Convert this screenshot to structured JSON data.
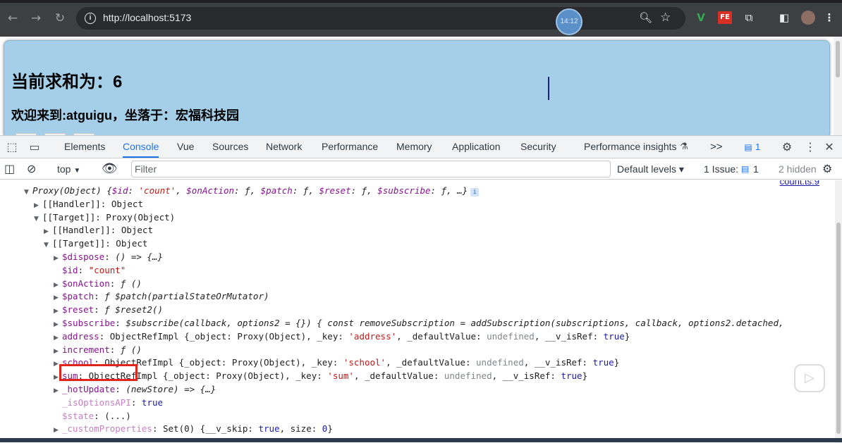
{
  "browser": {
    "url": "http://localhost:5173",
    "timer": "14:12",
    "extensions": [
      "V",
      "FE"
    ]
  },
  "page": {
    "sum_text": "当前求和为：6",
    "welcome_text": "欢迎来到:atguigu，坐落于：宏福科技园"
  },
  "devtools": {
    "tabs": [
      "Elements",
      "Console",
      "Vue",
      "Sources",
      "Network",
      "Performance",
      "Memory",
      "Application",
      "Security",
      "Performance insights"
    ],
    "more": ">>",
    "messages_count": "1",
    "context": "top",
    "filter_placeholder": "Filter",
    "levels": "Default levels ▾",
    "issues_label": "1 Issue:",
    "issues_count": "1",
    "hidden": "2 hidden",
    "source_link": "count.ts:9"
  },
  "console": {
    "lines": [
      {
        "t": "▼",
        "indent": 0,
        "parts": [
          [
            "i",
            "Proxy(Object) "
          ],
          [
            "i",
            "{"
          ],
          [
            "ki",
            "$id"
          ],
          [
            "i",
            ": "
          ],
          [
            "si",
            "'count'"
          ],
          [
            "i",
            ", "
          ],
          [
            "ki",
            "$onAction"
          ],
          [
            "i",
            ": ƒ, "
          ],
          [
            "ki",
            "$patch"
          ],
          [
            "i",
            ": ƒ, "
          ],
          [
            "ki",
            "$reset"
          ],
          [
            "i",
            ": ƒ, "
          ],
          [
            "ki",
            "$subscribe"
          ],
          [
            "i",
            ": ƒ, …}"
          ]
        ],
        "badge": "i"
      },
      {
        "t": "▶",
        "indent": 1,
        "parts": [
          [
            "",
            "[[Handler]]: Object"
          ]
        ]
      },
      {
        "t": "▼",
        "indent": 1,
        "parts": [
          [
            "",
            "[[Target]]: Proxy(Object)"
          ]
        ]
      },
      {
        "t": "▶",
        "indent": 2,
        "parts": [
          [
            "",
            "[[Handler]]: Object"
          ]
        ]
      },
      {
        "t": "▼",
        "indent": 2,
        "parts": [
          [
            "",
            "[[Target]]: Object"
          ]
        ]
      },
      {
        "t": "▶",
        "indent": 3,
        "parts": [
          [
            "k",
            "$dispose"
          ],
          [
            "",
            ": "
          ],
          [
            "i",
            "() => {…}"
          ]
        ]
      },
      {
        "t": "",
        "indent": 3,
        "parts": [
          [
            "k",
            "$id"
          ],
          [
            "",
            ": "
          ],
          [
            "s",
            "\"count\""
          ]
        ]
      },
      {
        "t": "▶",
        "indent": 3,
        "parts": [
          [
            "k",
            "$onAction"
          ],
          [
            "",
            ": "
          ],
          [
            "i",
            "ƒ ()"
          ]
        ]
      },
      {
        "t": "▶",
        "indent": 3,
        "parts": [
          [
            "k",
            "$patch"
          ],
          [
            "",
            ": "
          ],
          [
            "i",
            "ƒ $patch(partialStateOrMutator)"
          ]
        ]
      },
      {
        "t": "▶",
        "indent": 3,
        "parts": [
          [
            "k",
            "$reset"
          ],
          [
            "",
            ": "
          ],
          [
            "i",
            "ƒ $reset2()"
          ]
        ]
      },
      {
        "t": "▶",
        "indent": 3,
        "parts": [
          [
            "k",
            "$subscribe"
          ],
          [
            "",
            ": "
          ],
          [
            "i",
            "$subscribe(callback, options2 = {}) { const removeSubscription = addSubscription(subscriptions, callback, options2.detached,"
          ]
        ]
      },
      {
        "t": "▶",
        "indent": 3,
        "parts": [
          [
            "k",
            "address"
          ],
          [
            "",
            ": ObjectRefImpl {_object: Proxy(Object), _key: "
          ],
          [
            "s",
            "'address'"
          ],
          [
            "",
            ", _defaultValue: "
          ],
          [
            "g",
            "undefined"
          ],
          [
            "",
            ", __v_isRef: "
          ],
          [
            "n",
            "true"
          ],
          [
            "",
            "}"
          ]
        ]
      },
      {
        "t": "▶",
        "indent": 3,
        "parts": [
          [
            "k",
            "increment"
          ],
          [
            "",
            ": "
          ],
          [
            "i",
            "ƒ ()"
          ]
        ]
      },
      {
        "t": "▶",
        "indent": 3,
        "parts": [
          [
            "k",
            "school"
          ],
          [
            "",
            ": ObjectRefImpl {_object: Proxy(Object), _key: "
          ],
          [
            "s",
            "'school'"
          ],
          [
            "",
            ", _defaultValue: "
          ],
          [
            "g",
            "undefined"
          ],
          [
            "",
            ", __v_isRef: "
          ],
          [
            "n",
            "true"
          ],
          [
            "",
            "}"
          ]
        ]
      },
      {
        "t": "▶",
        "indent": 3,
        "parts": [
          [
            "k",
            "sum"
          ],
          [
            "",
            ": ObjectRefImpl {_object: Proxy(Object), _key: "
          ],
          [
            "s",
            "'sum'"
          ],
          [
            "",
            ", _defaultValue: "
          ],
          [
            "g",
            "undefined"
          ],
          [
            "",
            ", __v_isRef: "
          ],
          [
            "n",
            "true"
          ],
          [
            "",
            "}"
          ]
        ]
      },
      {
        "t": "▶",
        "indent": 3,
        "parts": [
          [
            "k",
            "_hotUpdate"
          ],
          [
            "",
            ": "
          ],
          [
            "i",
            "(newStore) => {…}"
          ]
        ]
      },
      {
        "t": "",
        "indent": 3,
        "parts": [
          [
            "kd",
            "_isOptionsAPI"
          ],
          [
            "",
            ": "
          ],
          [
            "n",
            "true"
          ]
        ]
      },
      {
        "t": "",
        "indent": 3,
        "parts": [
          [
            "kd",
            "$state"
          ],
          [
            "",
            ": (...)"
          ]
        ]
      },
      {
        "t": "▶",
        "indent": 3,
        "parts": [
          [
            "kd",
            "_customProperties"
          ],
          [
            "",
            ": Set(0) {__v_skip: "
          ],
          [
            "n",
            "true"
          ],
          [
            "",
            ", size: "
          ],
          [
            "n",
            "0"
          ],
          [
            "",
            "}"
          ]
        ]
      }
    ]
  }
}
